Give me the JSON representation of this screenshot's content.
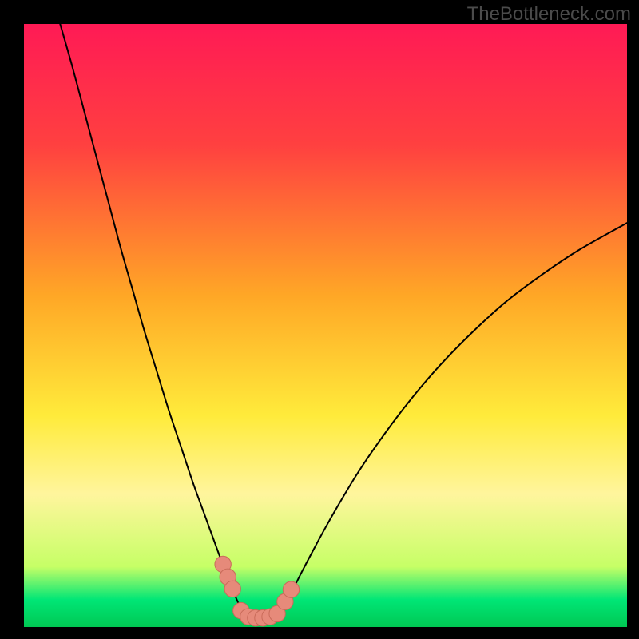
{
  "watermark": "TheBottleneck.com",
  "chart_data": {
    "type": "line",
    "title": "",
    "xlabel": "",
    "ylabel": "",
    "xlim": [
      0,
      100
    ],
    "ylim": [
      0,
      100
    ],
    "background_gradient": {
      "stops": [
        {
          "pos": 0.0,
          "color": "#ff1a55"
        },
        {
          "pos": 0.2,
          "color": "#ff4040"
        },
        {
          "pos": 0.45,
          "color": "#ffa726"
        },
        {
          "pos": 0.65,
          "color": "#ffeb3b"
        },
        {
          "pos": 0.78,
          "color": "#fff59d"
        },
        {
          "pos": 0.9,
          "color": "#c6ff66"
        },
        {
          "pos": 0.955,
          "color": "#00e676"
        },
        {
          "pos": 1.0,
          "color": "#00c853"
        }
      ]
    },
    "series": [
      {
        "name": "left-curve",
        "color": "#000000",
        "stroke_width": 2,
        "x": [
          6,
          8,
          10,
          12,
          14,
          16,
          18,
          20,
          22,
          24,
          26,
          28,
          30,
          32,
          33,
          34,
          35,
          36
        ],
        "y": [
          100,
          93,
          85.5,
          78,
          70.5,
          63,
          56,
          49,
          42.5,
          36,
          30,
          24,
          18.5,
          13,
          10.3,
          7.7,
          5.2,
          3
        ]
      },
      {
        "name": "right-curve",
        "color": "#000000",
        "stroke_width": 2,
        "x": [
          43,
          44,
          46,
          48,
          50,
          52,
          55,
          58,
          62,
          66,
          70,
          75,
          80,
          86,
          92,
          100
        ],
        "y": [
          3,
          5,
          9,
          12.8,
          16.5,
          20,
          25,
          29.5,
          35,
          40,
          44.5,
          49.5,
          54,
          58.5,
          62.5,
          67
        ]
      }
    ],
    "markers": {
      "name": "bead-markers",
      "color": "#e68a7a",
      "stroke": "#c96b5a",
      "radius_units": 1.35,
      "points": [
        {
          "x": 33.0,
          "y": 10.4
        },
        {
          "x": 33.8,
          "y": 8.3
        },
        {
          "x": 34.6,
          "y": 6.3
        },
        {
          "x": 36.0,
          "y": 2.7
        },
        {
          "x": 37.2,
          "y": 1.7
        },
        {
          "x": 38.4,
          "y": 1.5
        },
        {
          "x": 39.6,
          "y": 1.5
        },
        {
          "x": 40.8,
          "y": 1.7
        },
        {
          "x": 42.0,
          "y": 2.2
        },
        {
          "x": 43.3,
          "y": 4.2
        },
        {
          "x": 44.3,
          "y": 6.2
        }
      ]
    }
  }
}
